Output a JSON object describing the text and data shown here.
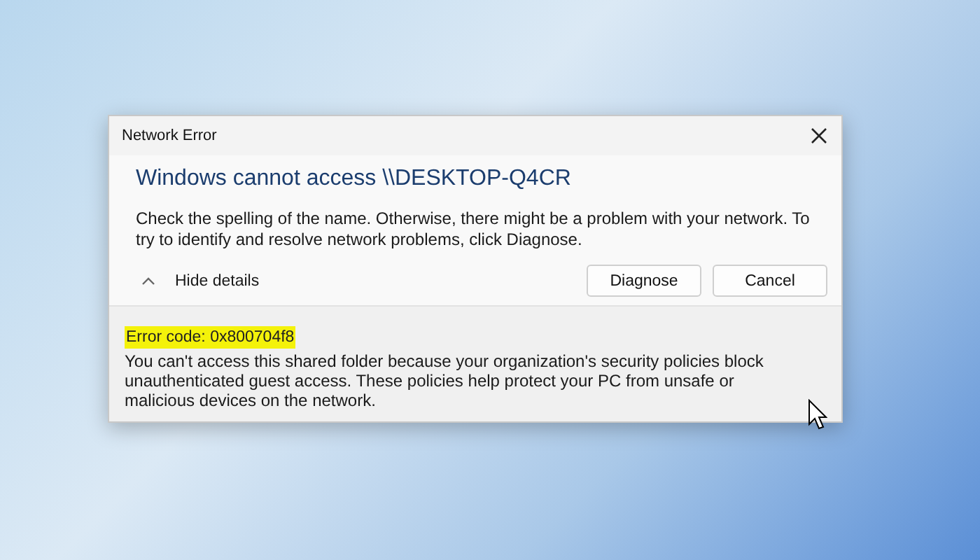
{
  "window": {
    "title": "Network Error"
  },
  "heading": "Windows cannot access \\\\DESKTOP-Q4CR",
  "message": "Check the spelling of the name. Otherwise, there might be a problem with your network. To try to identify and resolve network problems, click Diagnose.",
  "details_toggle": {
    "label": "Hide details",
    "expanded": true
  },
  "buttons": [
    {
      "label": "Diagnose"
    },
    {
      "label": "Cancel"
    }
  ],
  "details": {
    "error_code": {
      "text": "Error code: 0x800704f8",
      "highlighted": true
    },
    "description": "You can't access this shared folder because your organization's security policies block unauthenticated guest access. These policies help protect your PC from unsafe or malicious devices on the network."
  }
}
